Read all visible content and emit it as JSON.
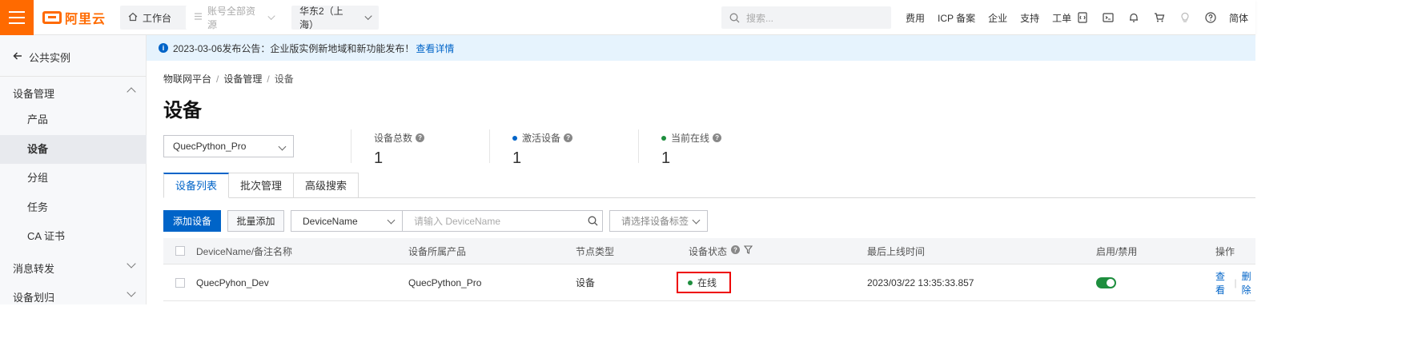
{
  "topbar": {
    "logo_text": "阿里云",
    "workbench_label": "工作台",
    "resource_scope_label": "账号全部资源",
    "region_label": "华东2（上海）",
    "search_placeholder": "搜索...",
    "links": [
      "费用",
      "ICP 备案",
      "企业",
      "支持",
      "工单"
    ],
    "icons": [
      "api-icon",
      "terminal-icon",
      "bell-icon",
      "cart-icon",
      "lightbulb-icon",
      "help-icon"
    ],
    "language_label": "简体",
    "brand_color": "#ff6a00"
  },
  "sidebar": {
    "back_label": "公共实例",
    "group_device_mgmt": "设备管理",
    "items": [
      "产品",
      "设备",
      "分组",
      "任务",
      "CA 证书"
    ],
    "active_item": "设备",
    "group_message": "消息转发",
    "group_device_assign": "设备划归"
  },
  "notice": {
    "text": "2023-03-06发布公告：企业版实例新地域和新功能发布！",
    "link": "查看详情"
  },
  "breadcrumb": [
    "物联网平台",
    "设备管理",
    "设备"
  ],
  "page_title": "设备",
  "product_select": "QuecPython_Pro",
  "stats": {
    "total_label": "设备总数",
    "total_value": "1",
    "activated_label": "激活设备",
    "activated_value": "1",
    "online_label": "当前在线",
    "online_value": "1",
    "activated_color": "#0064c8",
    "online_color": "#1e8e3e"
  },
  "tabs": [
    "设备列表",
    "批次管理",
    "高级搜索"
  ],
  "active_tab": "设备列表",
  "toolbar": {
    "add_device": "添加设备",
    "batch_add": "批量添加",
    "search_field": "DeviceName",
    "search_placeholder": "请输入 DeviceName",
    "tag_placeholder": "请选择设备标签"
  },
  "table": {
    "headers": [
      "DeviceName/备注名称",
      "设备所属产品",
      "节点类型",
      "设备状态",
      "最后上线时间",
      "启用/禁用",
      "操作"
    ],
    "rows": [
      {
        "device_name": "QuecPyhon_Dev",
        "product": "QuecPython_Pro",
        "node_type": "设备",
        "status": "在线",
        "last_online": "2023/03/22 13:35:33.857",
        "enabled": true,
        "action_view": "查看",
        "action_delete": "删除"
      }
    ]
  },
  "accent_color": "#0064c8"
}
